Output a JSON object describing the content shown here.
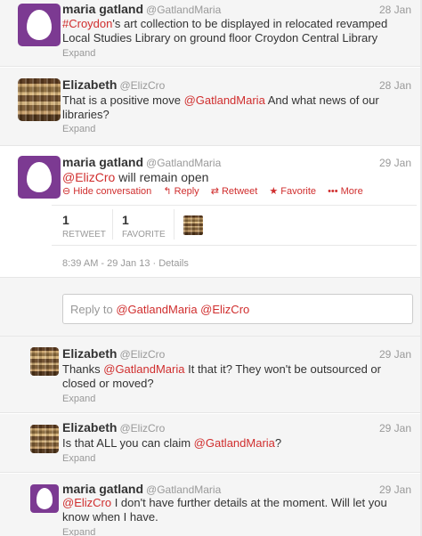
{
  "tweets": [
    {
      "name": "maria gatland",
      "handle": "@GatlandMaria",
      "time": "28 Jan",
      "text_link1": "#Croydon",
      "text_rest1": "'s art collection to be displayed in relocated revamped Local Studies Library on ground floor Croydon Central Library",
      "expand": "Expand",
      "avatar": "egg-avatar"
    },
    {
      "name": "Elizabeth",
      "handle": "@ElizCro",
      "time": "28 Jan",
      "text_pre": "That is a positive move ",
      "text_link1": "@GatlandMaria",
      "text_rest1": " And what news of our libraries?",
      "expand": "Expand",
      "avatar": "bookshelf-avatar"
    },
    {
      "name": "maria gatland",
      "handle": "@GatlandMaria",
      "time": "29 Jan",
      "text_link1": "@ElizCro",
      "text_rest1": " will remain open",
      "actions": {
        "hide": "Hide conversation",
        "reply": "Reply",
        "retweet": "Retweet",
        "favorite": "Favorite",
        "more": "More"
      },
      "stats": {
        "retweets": "1",
        "retweet_label": "RETWEET",
        "favorites": "1",
        "favorite_label": "FAVORITE"
      },
      "meta": "8:39 AM - 29 Jan 13 · Details",
      "avatar": "egg-avatar"
    },
    {
      "name": "Elizabeth",
      "handle": "@ElizCro",
      "time": "29 Jan",
      "text_pre": "Thanks ",
      "text_link1": "@GatlandMaria",
      "text_rest1": " It that it? They won't be outsourced or closed or moved?",
      "expand": "Expand",
      "avatar": "bookshelf-avatar"
    },
    {
      "name": "Elizabeth",
      "handle": "@ElizCro",
      "time": "29 Jan",
      "text_pre": "Is that ALL you can claim ",
      "text_link1": "@GatlandMaria",
      "text_rest1": "?",
      "expand": "Expand",
      "avatar": "bookshelf-avatar"
    },
    {
      "name": "maria gatland",
      "handle": "@GatlandMaria",
      "time": "29 Jan",
      "text_link1": "@ElizCro",
      "text_rest1": " I don't have further details at the moment. Will let you know when I have.",
      "expand": "Expand",
      "avatar": "egg-avatar"
    }
  ],
  "reply_box": {
    "prefix": "Reply to ",
    "mentions": "@GatlandMaria @ElizCro"
  },
  "colors": {
    "link": "#d02e2e",
    "egg_bg": "#7c3a92"
  }
}
